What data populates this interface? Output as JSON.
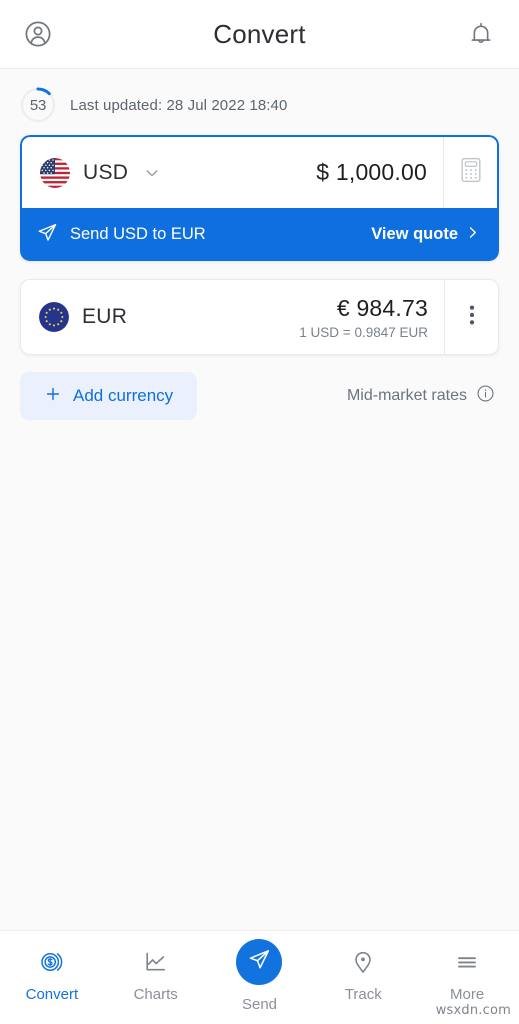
{
  "header": {
    "title": "Convert",
    "profile_icon": "user-circle-icon",
    "notification_icon": "bell-icon"
  },
  "status": {
    "countdown_value": "53",
    "last_updated": "Last updated: 28 Jul 2022 18:40"
  },
  "source": {
    "flag": "us-flag-icon",
    "code": "USD",
    "dropdown_icon": "chevron-down-icon",
    "amount": "$ 1,000.00",
    "calculator_icon": "calculator-icon"
  },
  "send_strip": {
    "send_icon": "paper-plane-icon",
    "label": "Send USD to EUR",
    "cta": "View quote",
    "cta_icon": "chevron-right-icon"
  },
  "target": {
    "flag": "eu-flag-icon",
    "code": "EUR",
    "amount": "€ 984.73",
    "rate": "1 USD = 0.9847 EUR",
    "menu_icon": "kebab-menu-icon"
  },
  "actions": {
    "add_currency_icon": "plus-icon",
    "add_currency": "Add currency",
    "mid_market": "Mid-market rates",
    "info_icon": "info-circle-icon"
  },
  "bottom_nav": [
    {
      "label": "Convert",
      "icon": "coin-dollar-icon",
      "active": true
    },
    {
      "label": "Charts",
      "icon": "line-chart-icon",
      "active": false
    },
    {
      "label": "Send",
      "icon": "paper-plane-icon",
      "active": false
    },
    {
      "label": "Track",
      "icon": "map-pin-icon",
      "active": false
    },
    {
      "label": "More",
      "icon": "hamburger-icon",
      "active": false
    }
  ],
  "watermark": "wsxdn.com",
  "colors": {
    "accent": "#0f6fde",
    "accent_nav": "#1273de",
    "page_bg": "#fafafa",
    "muted_text": "#6b7480",
    "add_currency_bg": "#eaf1fc"
  }
}
